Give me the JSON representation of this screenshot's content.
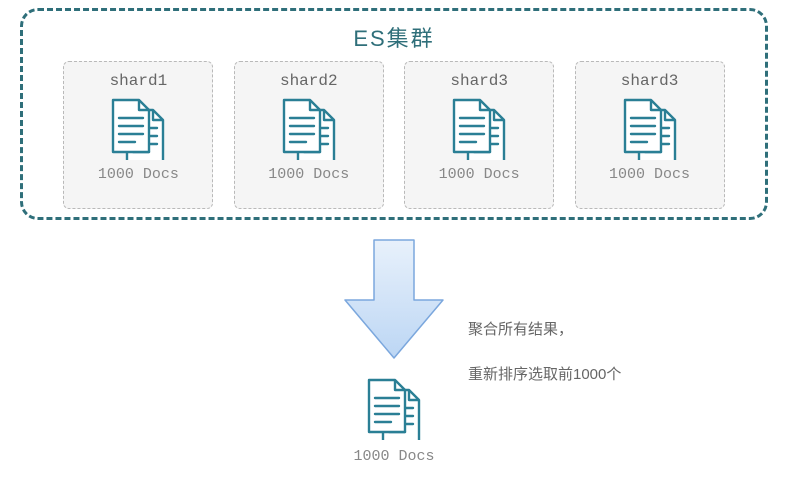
{
  "cluster": {
    "title": "ES集群",
    "shards": [
      {
        "label": "shard1",
        "docs": "1000 Docs"
      },
      {
        "label": "shard2",
        "docs": "1000 Docs"
      },
      {
        "label": "shard3",
        "docs": "1000 Docs"
      },
      {
        "label": "shard3",
        "docs": "1000 Docs"
      }
    ]
  },
  "annotation": {
    "line1": "聚合所有结果，",
    "line2": "重新排序选取前1000个"
  },
  "result": {
    "docs": "1000 Docs"
  },
  "colors": {
    "teal": "#2f6f7a",
    "iconStroke": "#2a7f95",
    "arrowFill": "#cfe2f9",
    "arrowStroke": "#7ba7dd"
  }
}
